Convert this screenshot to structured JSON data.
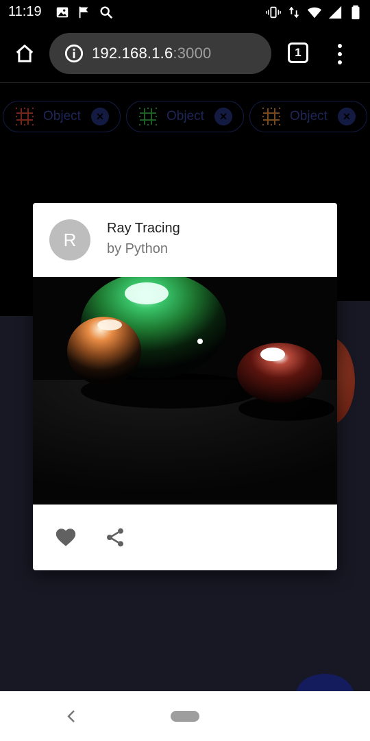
{
  "status_bar": {
    "time": "11:19",
    "left_icons": [
      "image-icon",
      "flag-icon",
      "search-icon"
    ],
    "right_icons": [
      "vibrate-icon",
      "data-arrows-icon",
      "wifi-icon",
      "signal-icon",
      "battery-icon"
    ]
  },
  "browser": {
    "url_host": "192.168.1.6",
    "url_port": ":3000",
    "tab_count": "1",
    "icons": {
      "home": "home-icon",
      "info": "info-icon",
      "menu": "more-vert-icon"
    }
  },
  "chips": [
    {
      "label": "Object",
      "icon_color": "#b23a2a",
      "icon": "grid-object-icon"
    },
    {
      "label": "Object",
      "icon_color": "#2f8f3a",
      "icon": "grid-object-icon"
    },
    {
      "label": "Object",
      "icon_color": "#b5722f",
      "icon": "grid-object-icon"
    }
  ],
  "card": {
    "avatar_letter": "R",
    "title": "Ray Tracing",
    "subtitle": "by Python",
    "actions": [
      "heart-icon",
      "share-icon"
    ]
  },
  "colors": {
    "accent_chip": "#1e2a66",
    "floor": "#262538",
    "avatar": "#bdbdbd"
  }
}
